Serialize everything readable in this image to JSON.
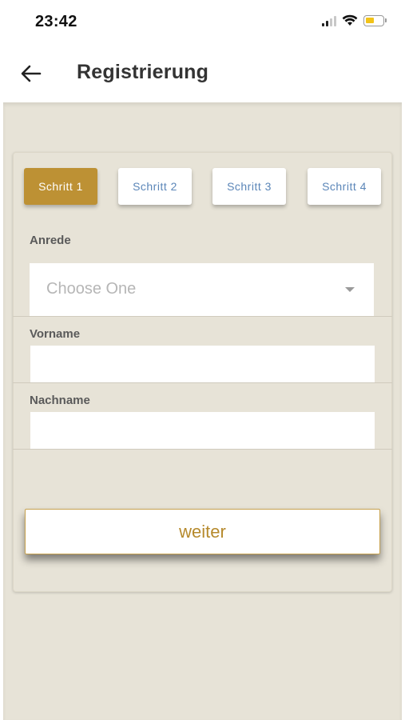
{
  "status_bar": {
    "time": "23:42",
    "icons": [
      "signal-icon",
      "wifi-icon",
      "battery-icon"
    ]
  },
  "app_bar": {
    "back_icon": "arrow-left-icon",
    "title": "Registrierung"
  },
  "steps": [
    {
      "label": "Schritt 1",
      "active": true
    },
    {
      "label": "Schritt 2",
      "active": false
    },
    {
      "label": "Schritt 3",
      "active": false
    },
    {
      "label": "Schritt 4",
      "active": false
    }
  ],
  "form": {
    "anrede": {
      "label": "Anrede",
      "placeholder": "Choose One",
      "value": ""
    },
    "vorname": {
      "label": "Vorname",
      "value": ""
    },
    "nachname": {
      "label": "Nachname",
      "value": ""
    }
  },
  "actions": {
    "weiter_label": "weiter"
  },
  "colors": {
    "accent": "#bd9134",
    "step_text": "#5b86b8",
    "background": "#e7e3d7",
    "button_border": "#c7a24f"
  }
}
